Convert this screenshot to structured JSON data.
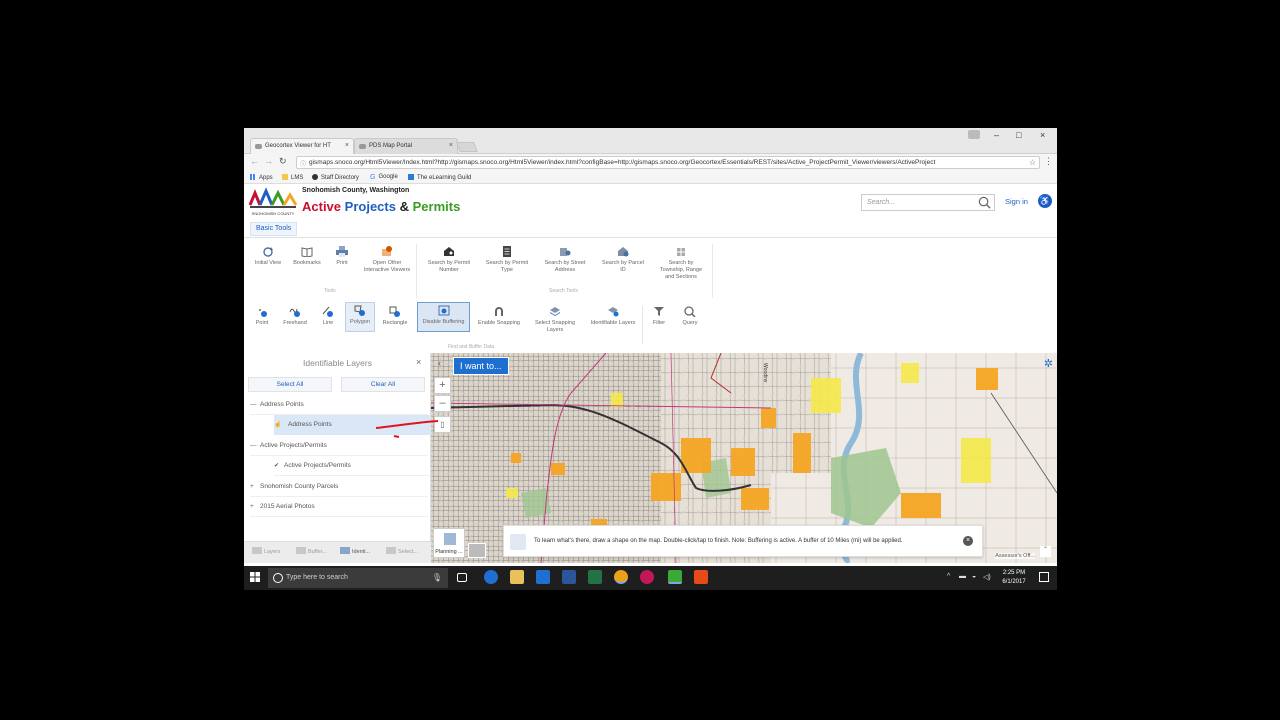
{
  "browser": {
    "tabs": [
      {
        "label": "Geocortex Viewer for HT",
        "active": true
      },
      {
        "label": "PDS Map Portal",
        "active": false
      }
    ],
    "url": "gismaps.snoco.org/Html5Viewer/Index.html?http://gismaps.snoco.org/Html5Viewer/index.html?configBase=http://gismaps.snoco.org/Geocortex/Essentials/REST/sites/Active_ProjectPermit_Viewer/viewers/ActiveProject",
    "bookmarks": [
      "Apps",
      "LMS",
      "Staff Directory",
      "Google",
      "The eLearning Guild"
    ]
  },
  "app": {
    "county": "Snohomish County, Washington",
    "logo_caption": "SNOHOMISH COUNTY",
    "title_part1": "Active",
    "title_part2": "Projects",
    "title_part3": "&",
    "title_part4": "Permits",
    "search_placeholder": "Search...",
    "sign_in": "Sign in",
    "basic_tab": "Basic Tools"
  },
  "tools_row1": [
    {
      "label": "Initial View",
      "icon": "refresh-icon"
    },
    {
      "label": "Bookmarks",
      "icon": "book-icon"
    },
    {
      "label": "Print",
      "icon": "printer-icon"
    },
    {
      "label": "Open Other Interactive Viewers",
      "icon": "viewer-icon"
    },
    {
      "label": "Search by Permit Number",
      "icon": "house-search-icon"
    },
    {
      "label": "Search by Permit Type",
      "icon": "document-icon"
    },
    {
      "label": "Search by Street Address",
      "icon": "address-icon"
    },
    {
      "label": "Search by Parcel ID",
      "icon": "parcel-icon"
    },
    {
      "label": "Search by Township, Range and Sections",
      "icon": "grid-icon"
    }
  ],
  "tools_row1_groups": {
    "tools": "Tools",
    "search": "Search Tools"
  },
  "tools_row2": [
    {
      "label": "Point",
      "icon": "point-icon"
    },
    {
      "label": "Freehand",
      "icon": "freehand-icon"
    },
    {
      "label": "Line",
      "icon": "line-icon"
    },
    {
      "label": "Polygon",
      "icon": "polygon-icon"
    },
    {
      "label": "Rectangle",
      "icon": "rectangle-icon"
    },
    {
      "label": "Disable Buffering",
      "icon": "buffer-icon"
    },
    {
      "label": "Enable Snapping",
      "icon": "magnet-icon"
    },
    {
      "label": "Select Snapping Layers",
      "icon": "layers-icon"
    },
    {
      "label": "Identifiable Layers",
      "icon": "layers-info-icon"
    },
    {
      "label": "Filter",
      "icon": "filter-icon"
    },
    {
      "label": "Query",
      "icon": "query-icon"
    }
  ],
  "tools_row2_group": "Find and Buffer Data",
  "panel": {
    "title": "Identifiable Layers",
    "select_all": "Select All",
    "clear_all": "Clear All",
    "layers": [
      {
        "label": "Address Points",
        "toggle": "—",
        "level": 0
      },
      {
        "label": "Address Points",
        "toggle": "",
        "level": 1
      },
      {
        "label": "Active Projects/Permits",
        "toggle": "—",
        "level": 0
      },
      {
        "label": "Active Projects/Permits",
        "toggle": "✔",
        "level": 1
      },
      {
        "label": "Snohomish County Parcels",
        "toggle": "+",
        "level": 0
      },
      {
        "label": "2015 Aerial Photos",
        "toggle": "+",
        "level": 0
      }
    ],
    "footer_tabs": [
      "Layers",
      "Buffer...",
      "Identi...",
      "Select..."
    ]
  },
  "map": {
    "i_want_to": "I want to...",
    "hint": "To learn what's there, draw a shape on the map. Double-click/tap to finish. Note: Buffering is active. A buffer of 10 Miles (mi) will be applied.",
    "planning_label": "Planning ...",
    "attribution": "Assessor's Off...",
    "colors": {
      "accent": "#1f6fd1",
      "permit": "#f5a623",
      "zoning": "#f5e94a"
    }
  },
  "taskbar": {
    "search_placeholder": "Type here to search",
    "time": "2:25 PM",
    "date": "6/1/2017"
  }
}
